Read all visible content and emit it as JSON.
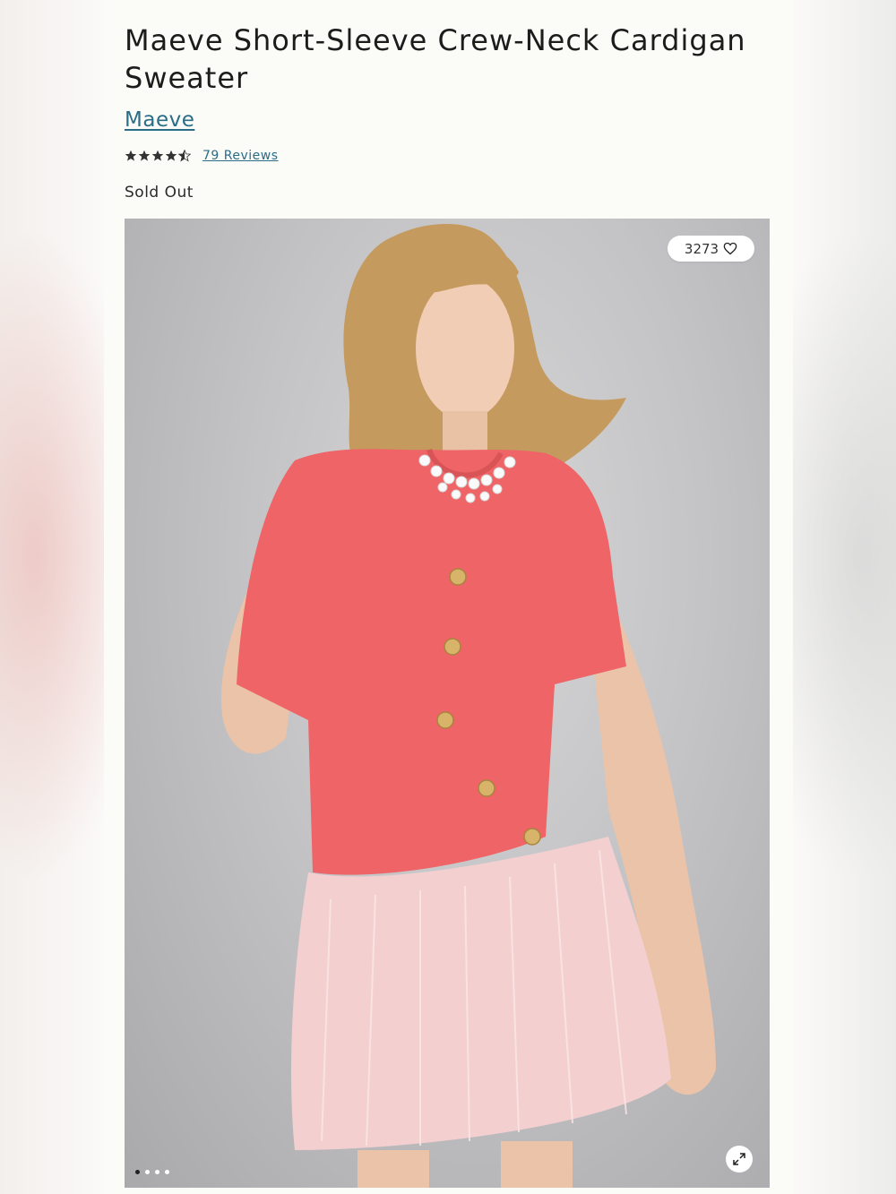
{
  "product": {
    "title": "Maeve Short-Sleeve Crew-Neck Cardigan Sweater",
    "brand": "Maeve",
    "rating": 4.5,
    "reviews_label": "79 Reviews",
    "status": "Sold Out"
  },
  "gallery": {
    "likes_count": "3273",
    "heart_icon": "heart-icon",
    "expand_icon": "expand-icon",
    "image_count": 4,
    "active_index": 0
  },
  "colors": {
    "link": "#2b6c86",
    "cardigan": "#ef6467",
    "skirt": "#f3cfd0"
  }
}
